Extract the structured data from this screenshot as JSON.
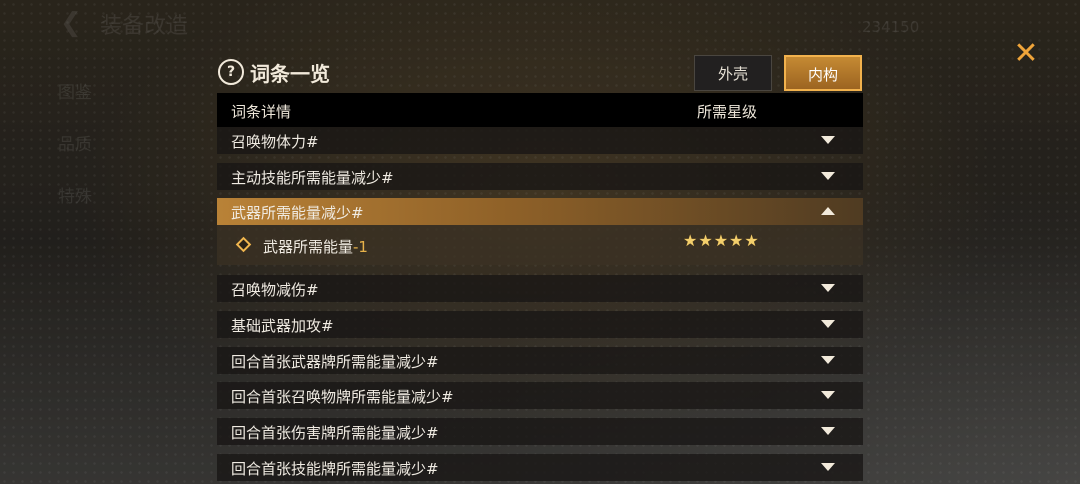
{
  "background": {
    "title": "装备改造",
    "coin_value": "234150",
    "side_tabs": [
      "图鉴",
      "品质",
      "特殊"
    ]
  },
  "panel": {
    "title": "词条一览",
    "help_icon": "?",
    "tabs": [
      {
        "label": "外壳",
        "active": false
      },
      {
        "label": "内构",
        "active": true
      }
    ],
    "columns": {
      "detail": "词条详情",
      "stars": "所需星级"
    },
    "rows": [
      {
        "label": "召唤物体力#",
        "expanded": false
      },
      {
        "label": "主动技能所需能量减少#",
        "expanded": false
      },
      {
        "label": "武器所需能量减少#",
        "expanded": true
      },
      {
        "label": "召唤物减伤#",
        "expanded": false
      },
      {
        "label": "基础武器加攻#",
        "expanded": false
      },
      {
        "label": "回合首张武器牌所需能量减少#",
        "expanded": false
      },
      {
        "label": "回合首张召唤物牌所需能量减少#",
        "expanded": false
      },
      {
        "label": "回合首张伤害牌所需能量减少#",
        "expanded": false
      },
      {
        "label": "回合首张技能牌所需能量减少#",
        "expanded": false
      }
    ],
    "expanded_detail": {
      "name": "武器所需能量",
      "value": "-1",
      "stars": 5
    }
  },
  "close_icon": "close-x-icon",
  "colors": {
    "accent": "#f0a53a",
    "active_row": "#b98237",
    "star": "#f3cf6c"
  }
}
